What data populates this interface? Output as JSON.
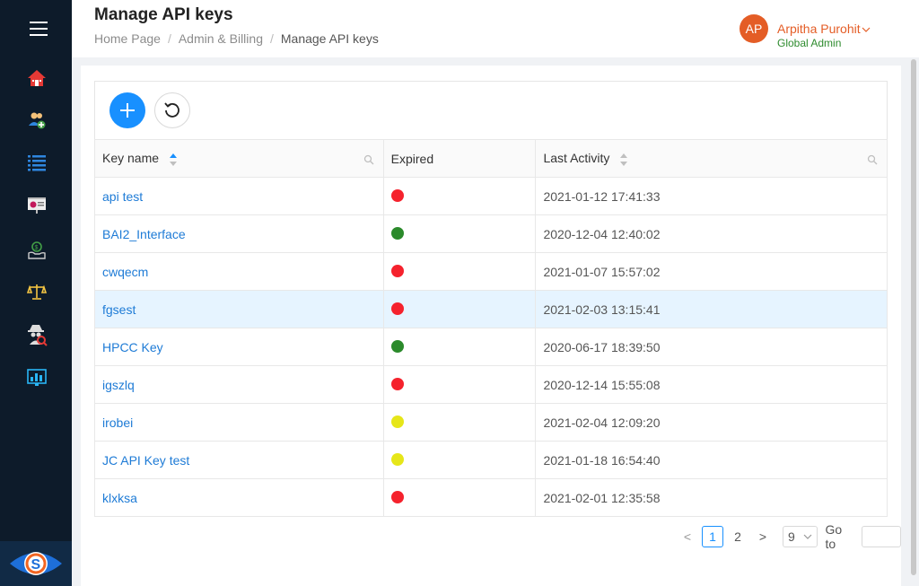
{
  "header": {
    "title": "Manage API keys",
    "breadcrumb": [
      "Home Page",
      "Admin & Billing",
      "Manage API keys"
    ],
    "breadcrumb_separator": "/"
  },
  "user": {
    "initials": "AP",
    "name": "Arpitha Purohit",
    "role": "Global Admin",
    "avatar_color": "#e45d26"
  },
  "sidebar": {
    "icons": [
      "home-icon",
      "add-user-icon",
      "list-icon",
      "presentation-icon",
      "money-hand-icon",
      "scales-icon",
      "spy-search-icon",
      "dashboard-chart-icon"
    ],
    "brand": "eye-logo-icon"
  },
  "toolbar": {
    "add_icon": "plus-icon",
    "refresh_icon": "refresh-icon"
  },
  "table": {
    "columns": [
      "Key name",
      "Expired",
      "Last Activity"
    ],
    "status_colors": {
      "red": "#f5222d",
      "green": "#2b8a2b",
      "yellow": "#e6e619"
    },
    "rows": [
      {
        "key": "api test",
        "status": "red",
        "last_activity": "2021-01-12 17:41:33"
      },
      {
        "key": "BAI2_Interface",
        "status": "green",
        "last_activity": "2020-12-04 12:40:02"
      },
      {
        "key": "cwqecm",
        "status": "red",
        "last_activity": "2021-01-07 15:57:02"
      },
      {
        "key": "fgsest",
        "status": "red",
        "last_activity": "2021-02-03 13:15:41"
      },
      {
        "key": "HPCC Key",
        "status": "green",
        "last_activity": "2020-06-17 18:39:50"
      },
      {
        "key": "igszlq",
        "status": "red",
        "last_activity": "2020-12-14 15:55:08"
      },
      {
        "key": "irobei",
        "status": "yellow",
        "last_activity": "2021-02-04 12:09:20"
      },
      {
        "key": "JC API Key test",
        "status": "yellow",
        "last_activity": "2021-01-18 16:54:40"
      },
      {
        "key": "klxksa",
        "status": "red",
        "last_activity": "2021-02-01 12:35:58"
      }
    ]
  },
  "pagination": {
    "prev": "<",
    "pages": [
      "1",
      "2"
    ],
    "current": "1",
    "next": ">",
    "page_size": "9",
    "goto_label": "Go to",
    "goto_value": ""
  }
}
